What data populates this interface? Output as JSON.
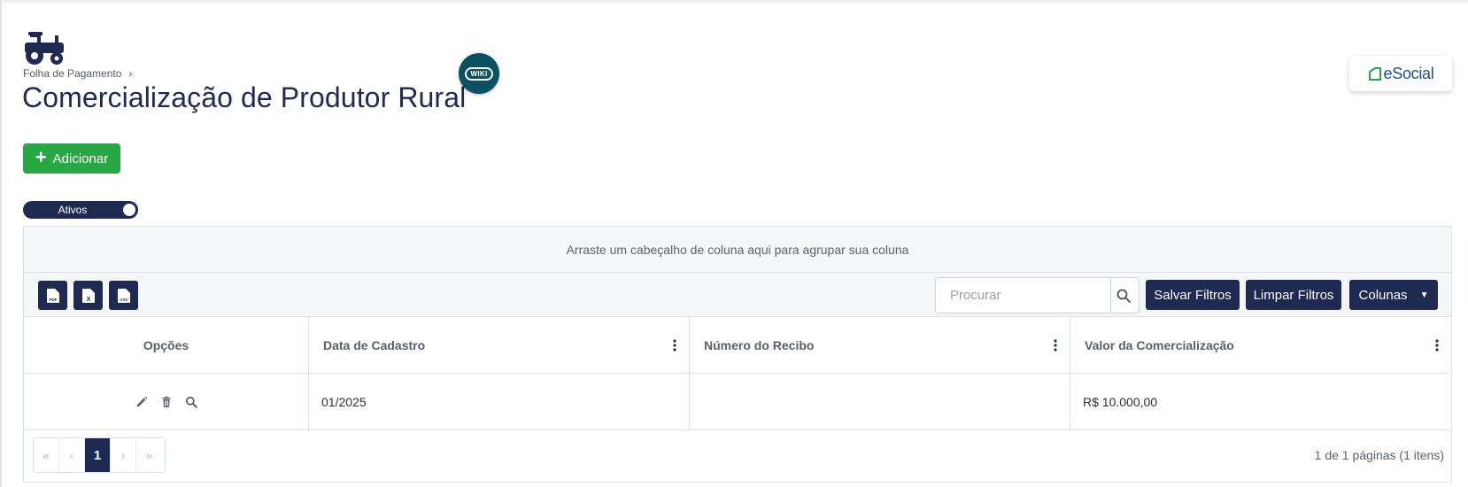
{
  "breadcrumb": {
    "parent": "Folha de Pagamento",
    "separator": "›"
  },
  "page": {
    "title": "Comercialização de Produtor Rural"
  },
  "wiki_badge": "WIKI",
  "esocial_logo": "eSocial",
  "actions": {
    "add_label": "Adicionar"
  },
  "status_toggle": {
    "label": "Ativos",
    "on": true
  },
  "grid": {
    "group_panel_text": "Arraste um cabeçalho de coluna aqui para agrupar sua coluna",
    "export_buttons": [
      "PDF",
      "X",
      "CSV"
    ],
    "search_placeholder": "Procurar",
    "save_filters_label": "Salvar Filtros",
    "clear_filters_label": "Limpar Filtros",
    "columns_label": "Colunas",
    "columns": [
      "Opções",
      "Data de Cadastro",
      "Número do Recibo",
      "Valor da Comercialização"
    ],
    "rows": [
      {
        "data_cadastro": "01/2025",
        "numero_recibo": "",
        "valor": "R$ 10.000,00"
      }
    ],
    "pagination": {
      "current_page": "1",
      "first": "«",
      "prev": "‹",
      "next": "›",
      "last": "»",
      "info": "1 de 1 páginas (1 itens)"
    }
  },
  "colors": {
    "navy": "#1f2a52",
    "green": "#28a745",
    "wiki_teal": "#0d4f63",
    "esocial_blue": "#1b4f8b",
    "esocial_green": "#2aa34a"
  }
}
